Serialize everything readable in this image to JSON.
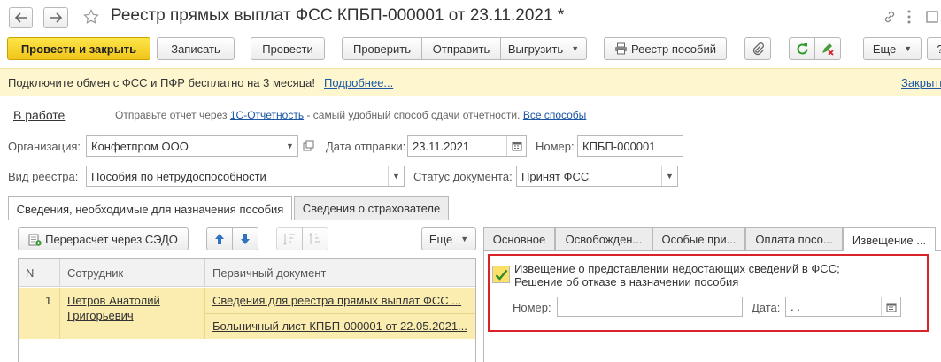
{
  "window": {
    "title": "Реестр прямых выплат ФСС КПБП-000001 от 23.11.2021 *",
    "back_icon": "arrow-left-icon",
    "forward_icon": "arrow-right-icon",
    "favorite_icon": "star-icon",
    "link_icon": "link-icon",
    "menu_icon": "more-vertical-icon",
    "maximize_icon": "maximize-icon",
    "close_icon": "close-icon"
  },
  "toolbar": {
    "post_close": "Провести и закрыть",
    "save": "Записать",
    "post": "Провести",
    "check": "Проверить",
    "send": "Отправить",
    "export": "Выгрузить",
    "benefits_registry": "Реестр пособий",
    "more": "Еще",
    "help": "?"
  },
  "banner": {
    "text": "Подключите обмен с ФСС и ПФР бесплатно на 3 месяца!",
    "more_link": "Подробнее...",
    "close_link": "Закрыть"
  },
  "status": {
    "state_link": "В работе",
    "hint_prefix": "Отправьте отчет через",
    "hint_link": "1С-Отчетность",
    "hint_suffix": "- самый удобный способ сдачи отчетности.",
    "all_methods_link": "Все способы"
  },
  "form": {
    "org_label": "Организация:",
    "org_value": "Конфетпром ООО",
    "send_date_label": "Дата отправки:",
    "send_date_value": "23.11.2021",
    "number_label": "Номер:",
    "number_value": "КПБП-000001",
    "registry_type_label": "Вид реестра:",
    "registry_type_value": "Пособия по нетрудоспособности",
    "doc_status_label": "Статус документа:",
    "doc_status_value": "Принят ФСС"
  },
  "main_tabs": [
    {
      "label": "Сведения, необходимые для назначения пособия"
    },
    {
      "label": "Сведения о страхователе"
    }
  ],
  "left_panel": {
    "recalc_button": "Перерасчет через СЭДО",
    "more": "Еще",
    "columns": [
      "N",
      "Сотрудник",
      "Первичный документ"
    ],
    "rows": [
      {
        "n": "1",
        "employee_line1": "Петров Анатолий",
        "employee_line2": "Григорьевич",
        "doc1": "Сведения для реестра прямых выплат ФСС ...",
        "doc2": "Больничный лист КПБП-000001 от 22.05.2021..."
      }
    ]
  },
  "right_tabs": [
    {
      "label": "Основное"
    },
    {
      "label": "Освобожден..."
    },
    {
      "label": "Особые при..."
    },
    {
      "label": "Оплата посо..."
    },
    {
      "label": "Извещение ..."
    }
  ],
  "notice": {
    "checked": true,
    "line1": "Извещение о представлении недостающих сведений в ФСС;",
    "line2": "Решение об отказе в назначении пособия",
    "number_label": "Номер:",
    "number_value": "",
    "date_label": "Дата:",
    "date_value": " .  .",
    "highlight_color": "#d9232a"
  },
  "colors": {
    "primary": "#f5cd2b",
    "banner_bg": "#fdf6cf",
    "selected_row": "#fbecb0",
    "link": "#1d57a6"
  }
}
